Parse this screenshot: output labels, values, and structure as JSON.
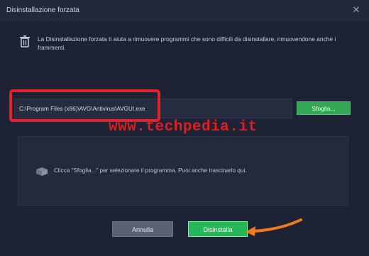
{
  "window": {
    "title": "Disinstallazione forzata",
    "close_icon": "close-icon"
  },
  "info": {
    "icon": "trash-icon",
    "text": "La Disinstallazione forzata ti aiuta a rimuovere programmi che sono difficili da disinstallare, rimuovendone anche i frammenti."
  },
  "path": {
    "value": "C:\\Program Files (x86)\\AVG\\Antivirus\\AVGUI.exe",
    "browse_label": "Sfoglia..."
  },
  "watermark": "www.techpedia.it",
  "dropzone": {
    "icon": "box-icon",
    "text": "Clicca \"Sfoglia...\" per selezionare il programma. Puoi anche trascinarlo qui."
  },
  "buttons": {
    "cancel_label": "Annulla",
    "uninstall_label": "Disinstalla"
  },
  "colors": {
    "highlight": "#e3222b",
    "arrow": "#f07a1a",
    "accent": "#28b65a"
  }
}
